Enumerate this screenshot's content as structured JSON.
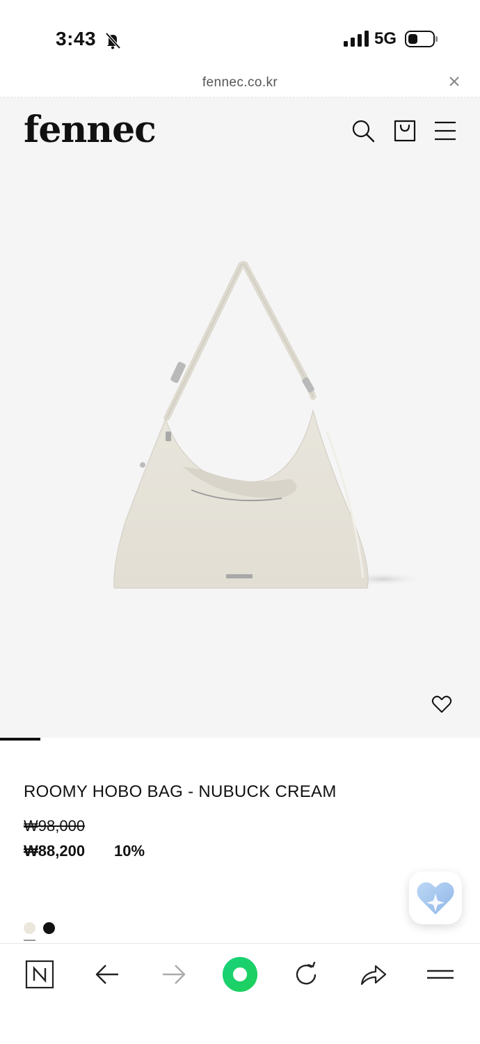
{
  "status_bar": {
    "time": "3:43",
    "network": "5G"
  },
  "browser": {
    "url": "fennec.co.kr"
  },
  "site": {
    "logo": "fennec"
  },
  "product": {
    "title": "ROOMY HOBO BAG - NUBUCK CREAM",
    "original_price": "₩98,000",
    "sale_price": "₩88,200",
    "discount": "10%",
    "colors": [
      {
        "name": "cream",
        "hex": "#ECE7DC",
        "selected": true
      },
      {
        "name": "black",
        "hex": "#111111",
        "selected": false
      }
    ],
    "image_slide": {
      "current": 1
    }
  },
  "icons": {
    "status": [
      "bell-slash-icon",
      "signal-icon",
      "battery-icon"
    ],
    "header": [
      "search-icon",
      "shopping-bag-icon",
      "menu-icon"
    ],
    "toolbar": [
      "naver-n-icon",
      "back-arrow-icon",
      "forward-arrow-icon",
      "green-dot-home-icon",
      "refresh-icon",
      "share-icon",
      "menu-icon"
    ]
  },
  "colors": {
    "hero_bg": "#F5F5F5",
    "accent_green": "#1ED760"
  }
}
